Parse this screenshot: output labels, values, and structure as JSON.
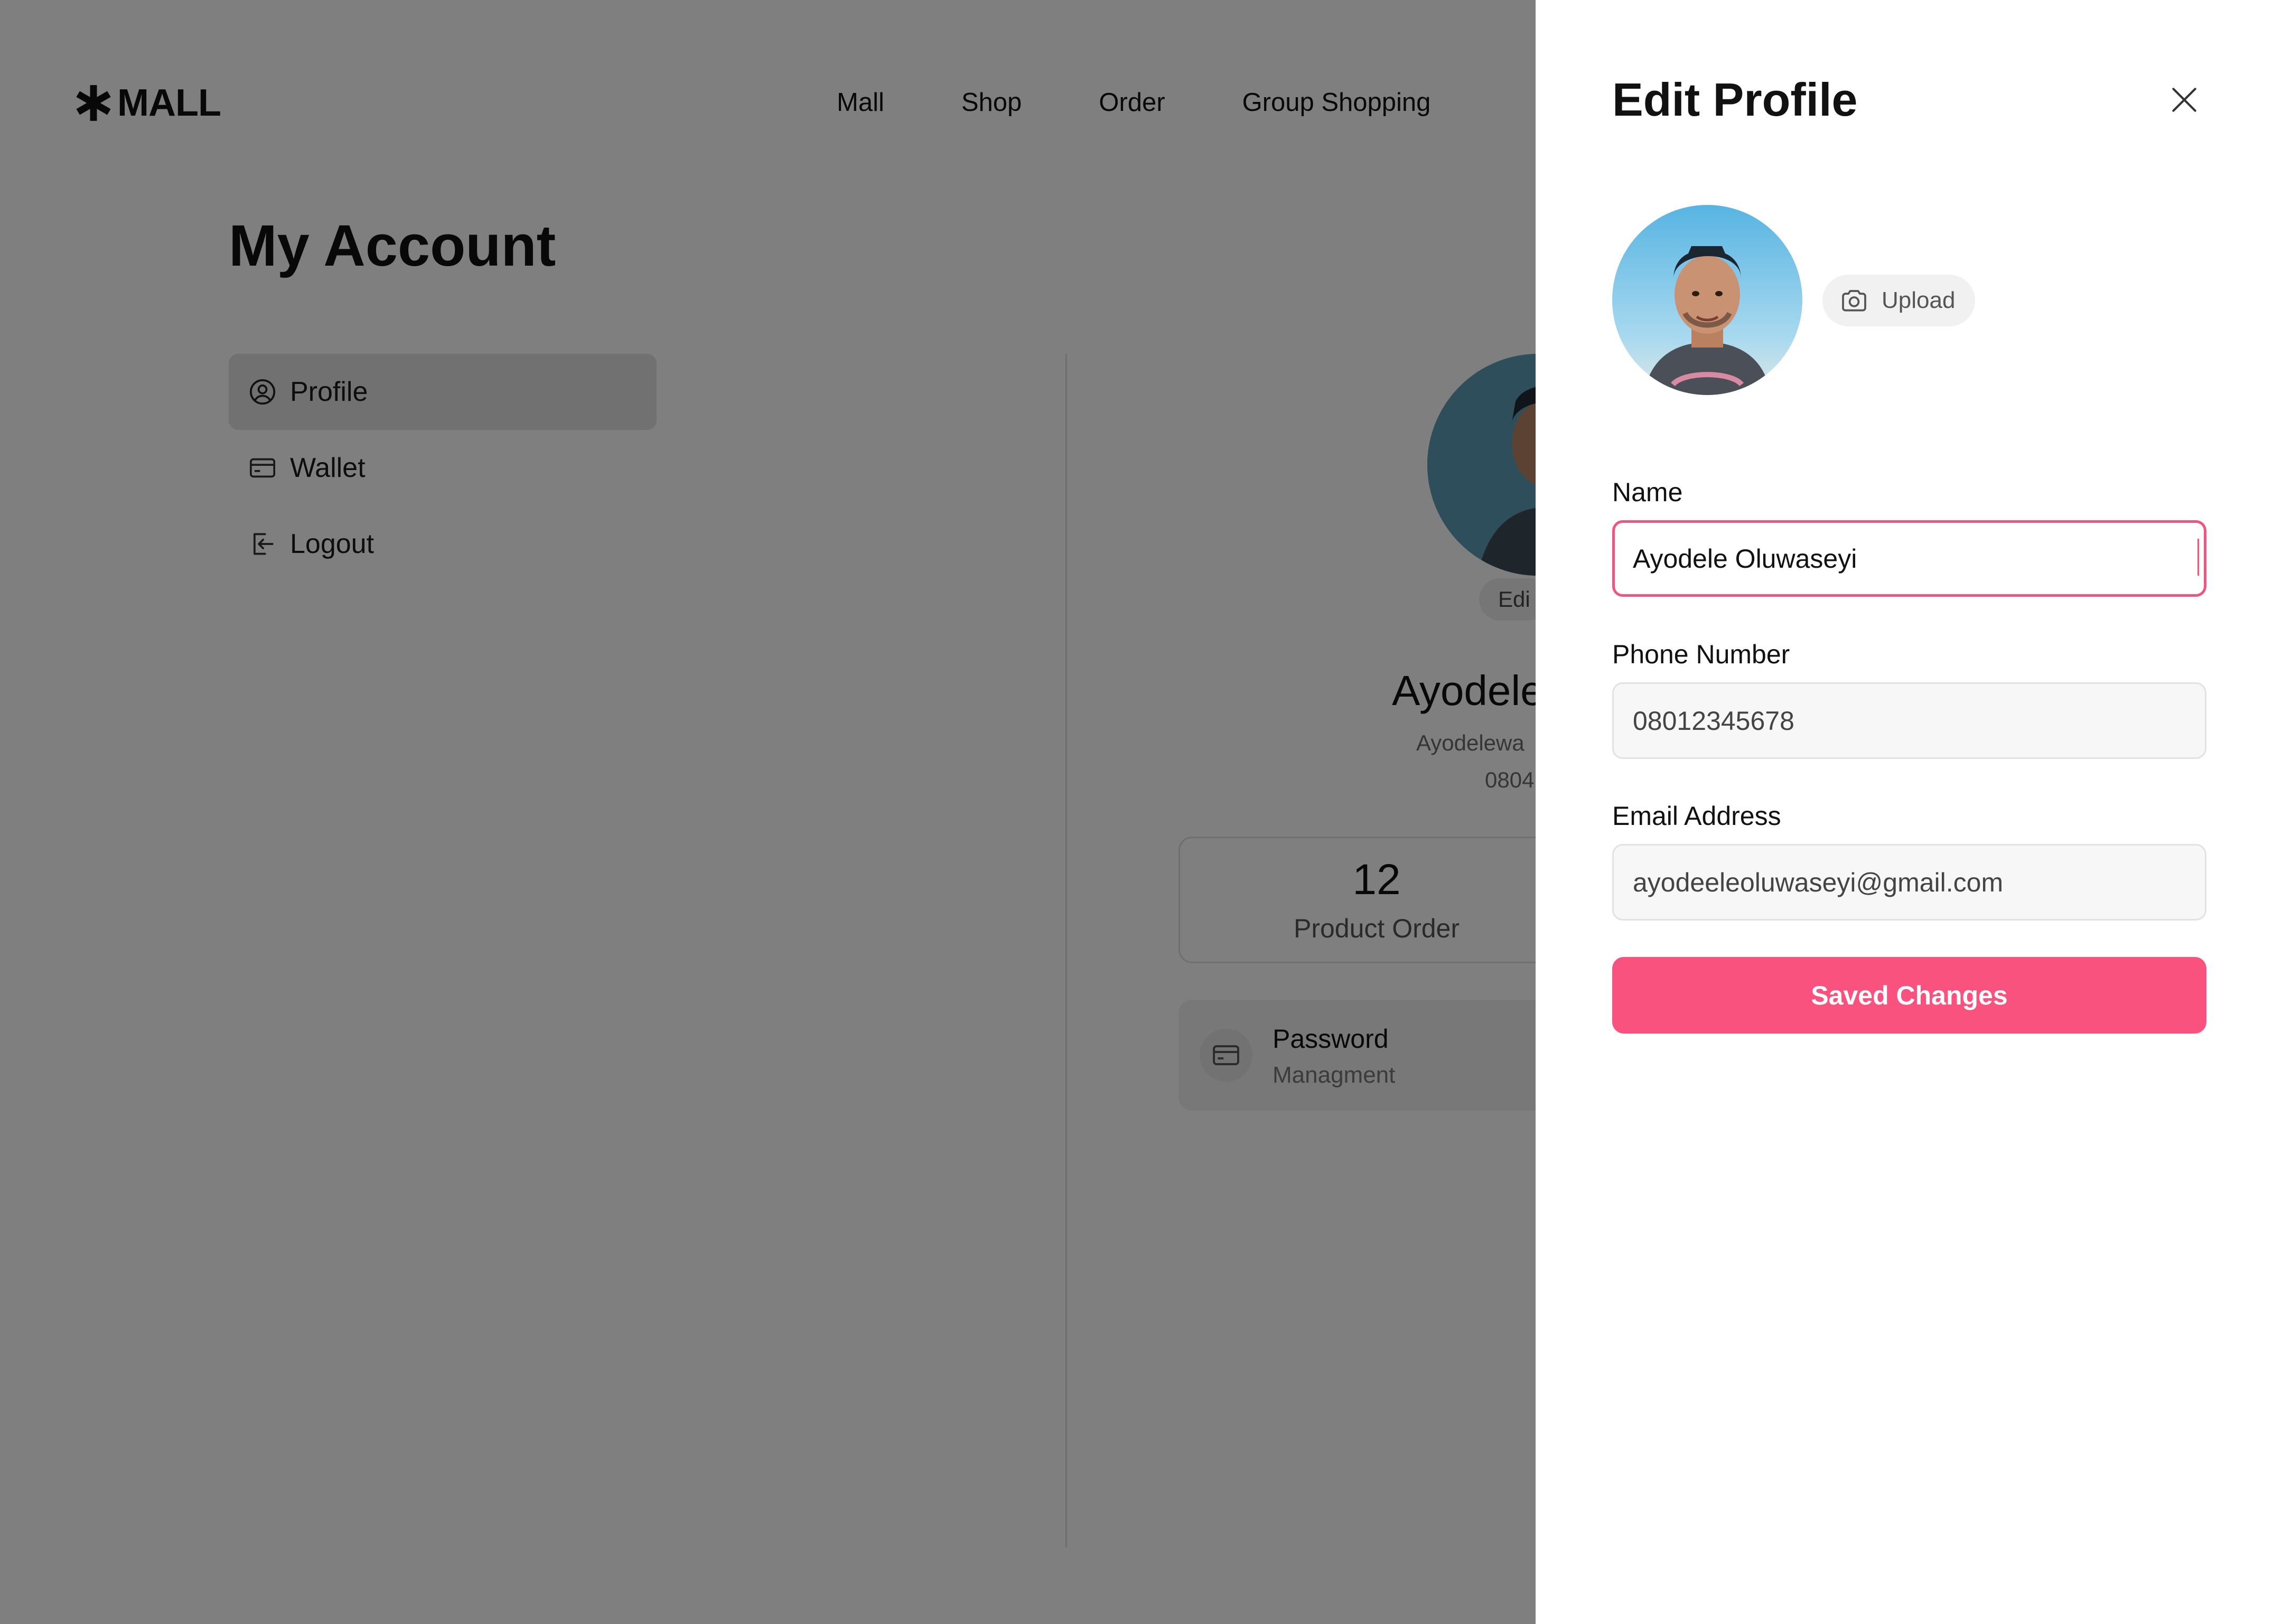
{
  "header": {
    "brand": "MALL",
    "nav": [
      "Mall",
      "Shop",
      "Order",
      "Group Shopping"
    ]
  },
  "account": {
    "title": "My Account",
    "sidebar": [
      {
        "label": "Profile",
        "icon": "user-circle-icon",
        "active": true
      },
      {
        "label": "Wallet",
        "icon": "card-icon",
        "active": false
      },
      {
        "label": "Logout",
        "icon": "logout-icon",
        "active": false
      }
    ],
    "profile_card": {
      "edit_label": "Edi",
      "name": "Ayodele",
      "email": "Ayodelewa",
      "phone": "0804",
      "stats": [
        {
          "value": "12",
          "label": "Product Order"
        }
      ],
      "password_title": "Password",
      "password_sub": "Managment"
    }
  },
  "drawer": {
    "title": "Edit Profile",
    "upload_label": "Upload",
    "form": {
      "name_label": "Name",
      "name_value": "Ayodele Oluwaseyi",
      "phone_label": "Phone Number",
      "phone_value": "08012345678",
      "email_label": "Email Address",
      "email_value": "ayodeeleoluwaseyi@gmail.com"
    },
    "save_label": "Saved Changes"
  },
  "colors": {
    "accent": "#f9527f",
    "focus_border": "#f0557f",
    "overlay": "rgba(0,0,0,0.5)"
  }
}
